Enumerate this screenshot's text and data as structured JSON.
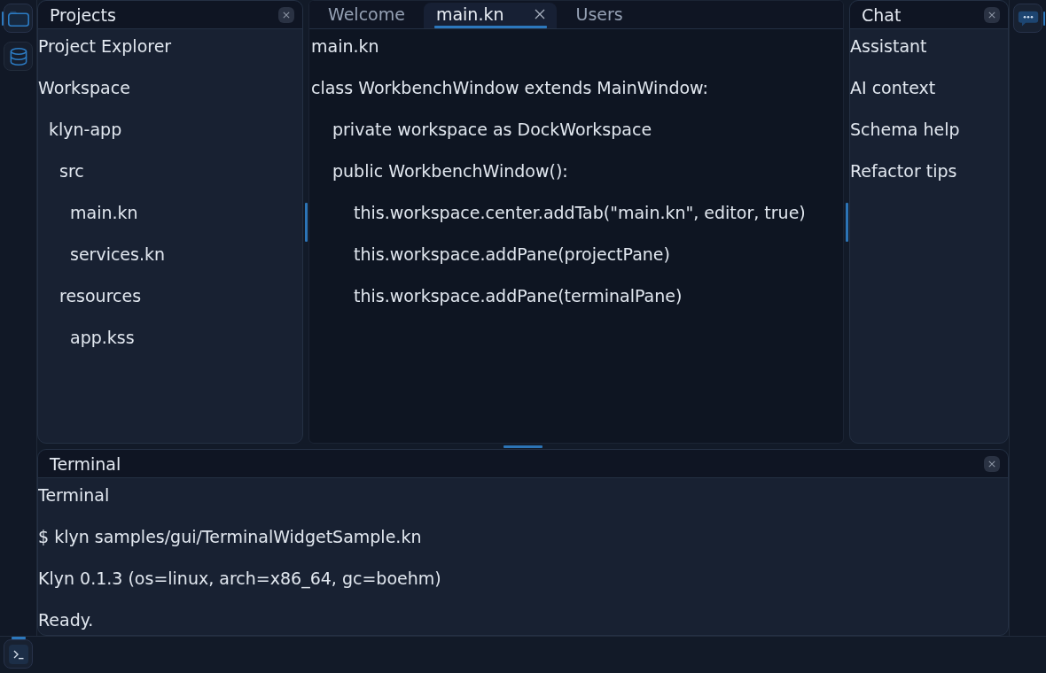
{
  "activity_bar_left": [
    {
      "kind": "folder",
      "selected": true
    },
    {
      "kind": "database",
      "selected": false
    }
  ],
  "projects_pane": {
    "title": "Projects",
    "heading": "Project Explorer",
    "tree": [
      {
        "label": "Workspace",
        "children": [
          {
            "label": "klyn-app",
            "children": [
              {
                "label": "src",
                "children": [
                  {
                    "label": "main.kn"
                  },
                  {
                    "label": "services.kn"
                  }
                ]
              },
              {
                "label": "resources",
                "children": [
                  {
                    "label": "app.kss"
                  }
                ]
              }
            ]
          }
        ]
      }
    ]
  },
  "editor": {
    "tabs": [
      {
        "label": "Welcome",
        "selected": false
      },
      {
        "label": "main.kn",
        "selected": true
      },
      {
        "label": "Users",
        "selected": false
      }
    ],
    "heading": "main.kn",
    "code": [
      {
        "text": "class WorkbenchWindow extends MainWindow:",
        "children": [
          {
            "text": "private workspace as DockWorkspace"
          },
          {
            "text": "public WorkbenchWindow():",
            "children": [
              {
                "text": "this.workspace.center.addTab(\"main.kn\", editor, true)"
              },
              {
                "text": "this.workspace.addPane(projectPane)"
              },
              {
                "text": "this.workspace.addPane(terminalPane)"
              }
            ]
          }
        ]
      }
    ]
  },
  "chat_pane": {
    "title": "Chat",
    "items": [
      "Assistant",
      "AI context",
      "Schema help",
      "Refactor tips"
    ]
  },
  "activity_bar_right": [
    {
      "kind": "chat",
      "selected": true
    }
  ],
  "terminal_pane": {
    "title": "Terminal",
    "lines": [
      "Terminal",
      "$ klyn samples/gui/TerminalWidgetSample.kn",
      "Klyn 0.1.3 (os=linux, arch=x86_64, gc=boehm)",
      "Ready."
    ]
  },
  "bottom_bar": [
    {
      "kind": "terminal",
      "selected": true
    }
  ]
}
